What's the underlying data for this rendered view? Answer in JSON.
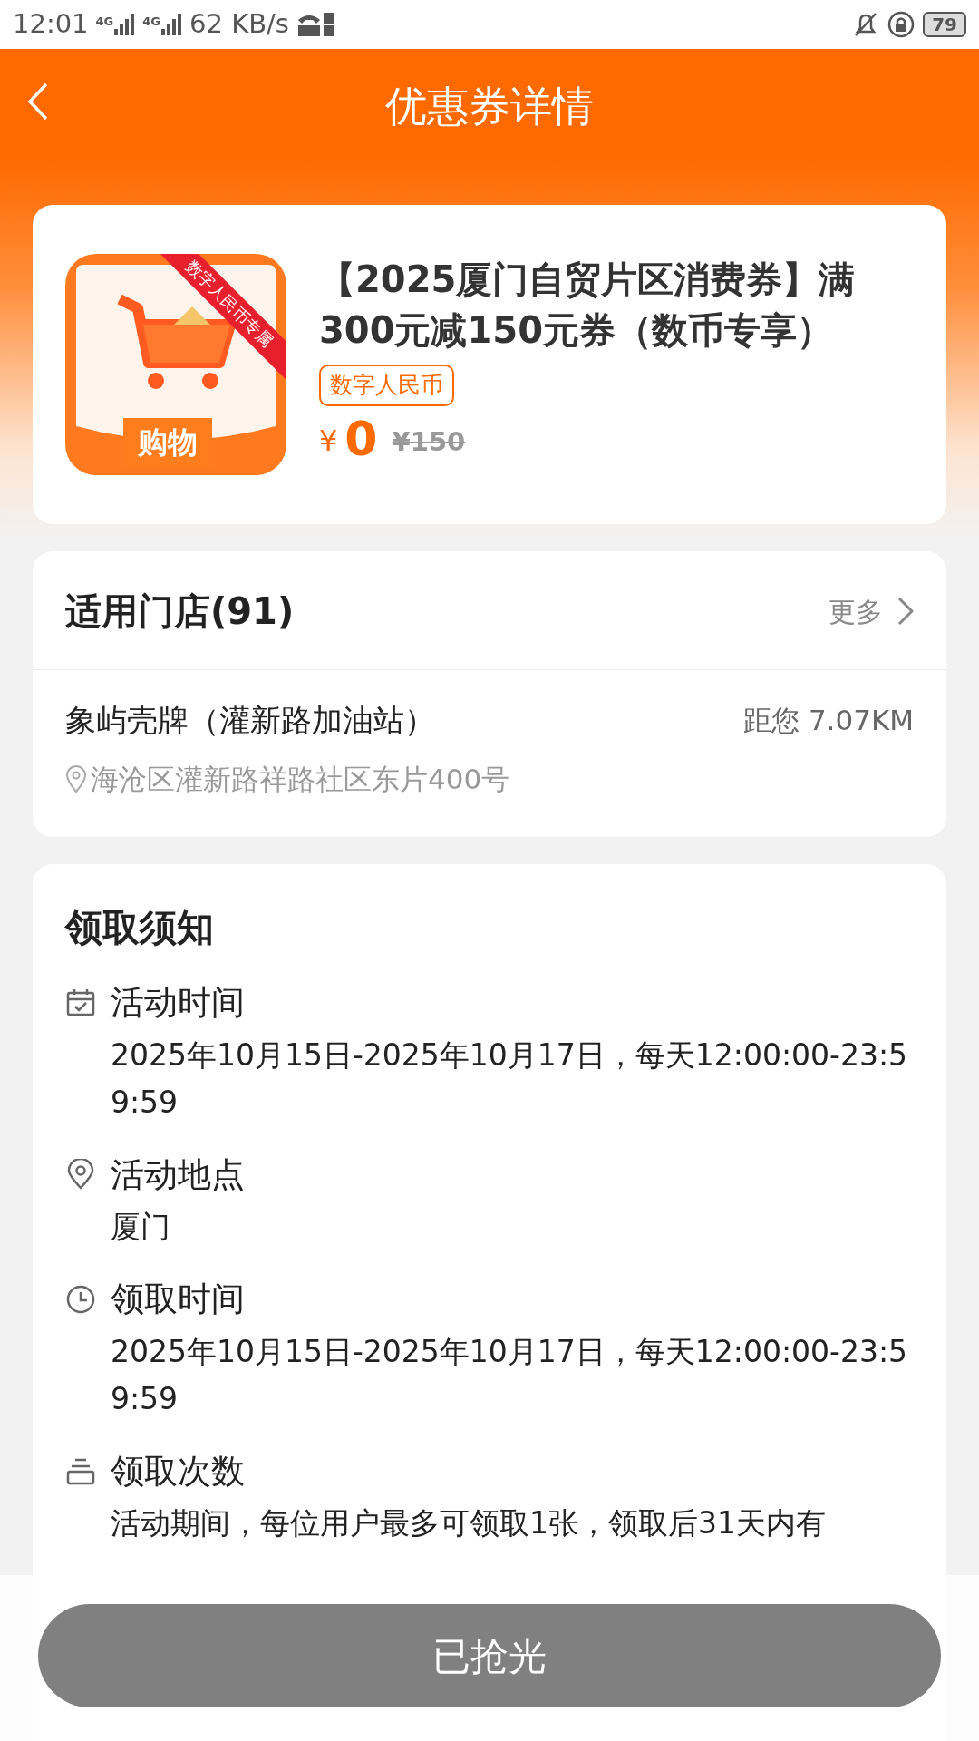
{
  "status_bar": {
    "time": "12:01",
    "network": [
      "4G",
      "4G"
    ],
    "speed": "62 KB/s",
    "battery": "79"
  },
  "header": {
    "title": "优惠券详情"
  },
  "coupon": {
    "ribbon": "数字人民币专属",
    "category": "购物",
    "title": "【2025厦门自贸片区消费券】满300元减150元券（数币专享）",
    "tag": "数字人民币",
    "currency": "¥",
    "price": "0",
    "original_price": "¥150"
  },
  "stores": {
    "title": "适用门店(91)",
    "more": "更多",
    "items": [
      {
        "name": "象屿壳牌（灌新路加油站）",
        "distance": "距您 7.07KM",
        "address": "海沧区灌新路祥路社区东片400号"
      }
    ]
  },
  "notice": {
    "title": "领取须知",
    "items": [
      {
        "kind": "calendar",
        "label": "活动时间",
        "text": "2025年10月15日-2025年10月17日，每天12:00:00-23:59:59"
      },
      {
        "kind": "location",
        "label": "活动地点",
        "text": "厦门"
      },
      {
        "kind": "clock",
        "label": "领取时间",
        "text": "2025年10月15日-2025年10月17日，每天12:00:00-23:59:59"
      },
      {
        "kind": "count",
        "label": "领取次数",
        "text": "活动期间，每位用户最多可领取1张，领取后31天内有"
      }
    ]
  },
  "action": {
    "label": "已抢光",
    "disabled": true
  }
}
